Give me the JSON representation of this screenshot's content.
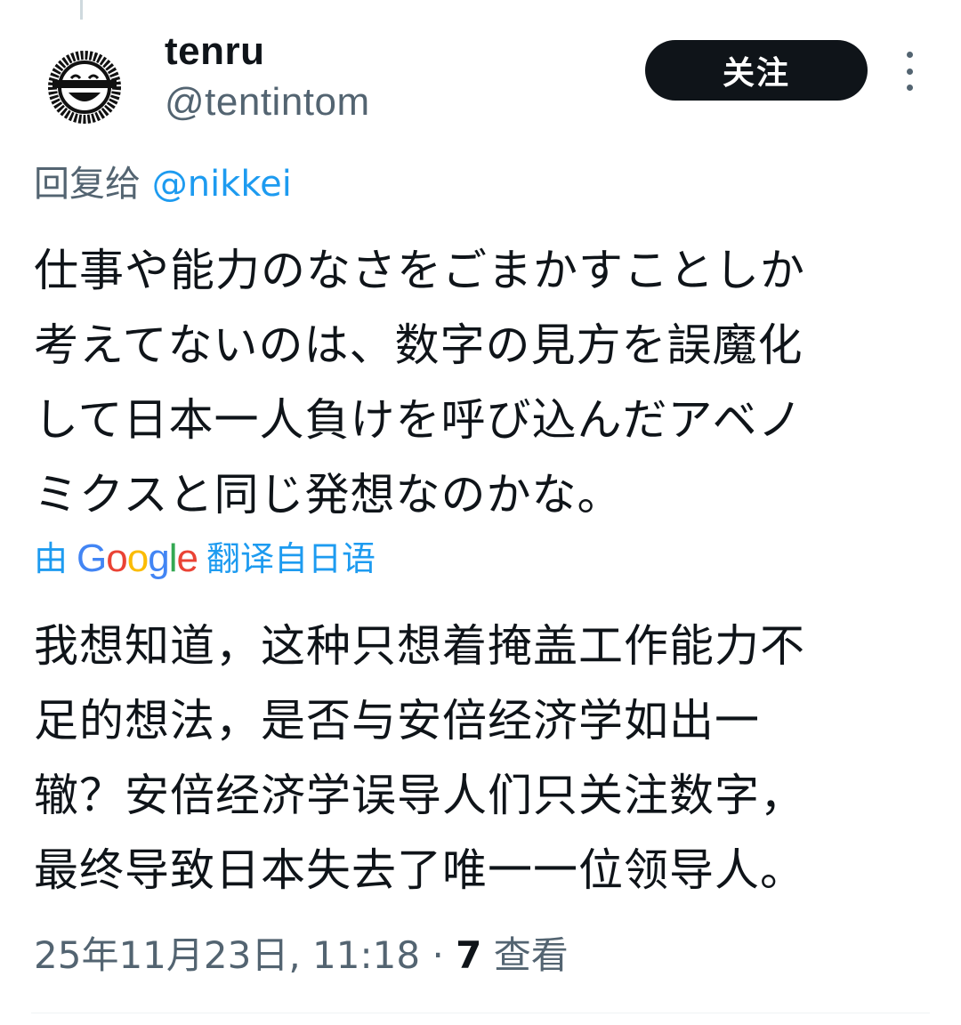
{
  "user": {
    "display_name": "tenru",
    "handle": "@tentintom",
    "avatar": "smiling-face-logo-avatar"
  },
  "follow_button": {
    "label": "关注"
  },
  "more_menu": {
    "icon": "more-vertical-icon"
  },
  "reply": {
    "prefix": "回复给",
    "mention": "@nikkei"
  },
  "tweet": {
    "lines": [
      "仕事や能力のなさをごまかすことしか",
      "考えてないのは、数字の見方を誤魔化",
      "して日本一人負けを呼び込んだアベノ",
      "ミクスと同じ発想なのかな。"
    ]
  },
  "translation": {
    "by_label": "由",
    "service": "Google",
    "source_label": "翻译自日语",
    "lines": [
      "我想知道，这种只想着掩盖工作能力不",
      "足的想法，是否与安倍经济学如出一",
      "辙？安倍经济学误导人们只关注数字，",
      "最终导致日本失去了唯一一位领导人。"
    ]
  },
  "meta": {
    "timestamp": "25年11月23日, 11:18",
    "separator": "·",
    "views_count": "7",
    "views_label": "查看"
  },
  "colors": {
    "text": "#0f1419",
    "secondary": "#536471",
    "link": "#1d9bf0",
    "button_bg": "#0f1419"
  }
}
